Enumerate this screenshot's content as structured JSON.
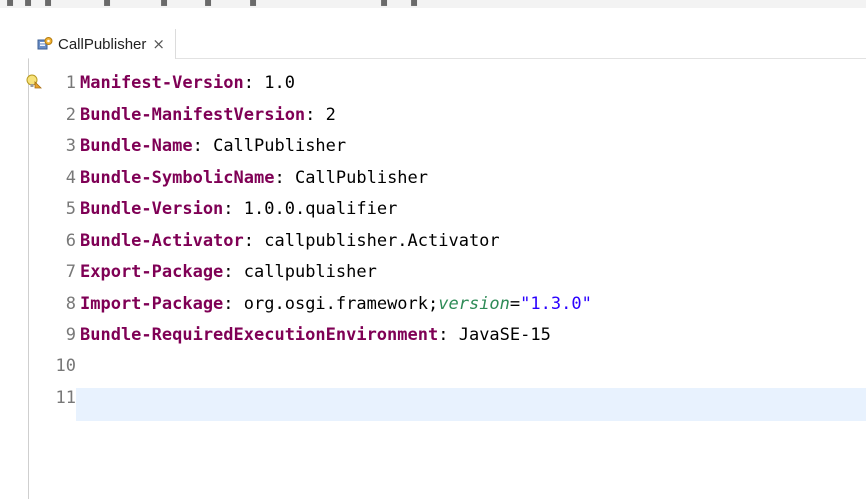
{
  "tab": {
    "title": "CallPublisher",
    "close_glyph": "×",
    "icon": "manifest-file-icon"
  },
  "annotation_icon": "lightbulb-warning-icon",
  "lines": [
    {
      "number": "1",
      "key": "Manifest-Version",
      "sep": ": ",
      "value": "1.0"
    },
    {
      "number": "2",
      "key": "Bundle-ManifestVersion",
      "sep": ": ",
      "value": "2"
    },
    {
      "number": "3",
      "key": "Bundle-Name",
      "sep": ": ",
      "value": "CallPublisher"
    },
    {
      "number": "4",
      "key": "Bundle-SymbolicName",
      "sep": ": ",
      "value": "CallPublisher"
    },
    {
      "number": "5",
      "key": "Bundle-Version",
      "sep": ": ",
      "value": "1.0.0.qualifier"
    },
    {
      "number": "6",
      "key": "Bundle-Activator",
      "sep": ": ",
      "value": "callpublisher.Activator"
    },
    {
      "number": "7",
      "key": "Export-Package",
      "sep": ": ",
      "value": "callpublisher"
    },
    {
      "number": "8",
      "key": "Import-Package",
      "sep": ": ",
      "value": "org.osgi.framework;",
      "attr": "version",
      "eq": "=",
      "str": "\"1.3.0\""
    },
    {
      "number": "9",
      "key": "Bundle-RequiredExecutionEnvironment",
      "sep": ": ",
      "value": "JavaSE-15"
    },
    {
      "number": "10"
    },
    {
      "number": "11"
    }
  ],
  "colors": {
    "header_key": "#7f0055",
    "attribute": "#2e8b57",
    "string": "#2a00ff",
    "line_number": "#787878",
    "current_line": "#e8f2fe"
  }
}
